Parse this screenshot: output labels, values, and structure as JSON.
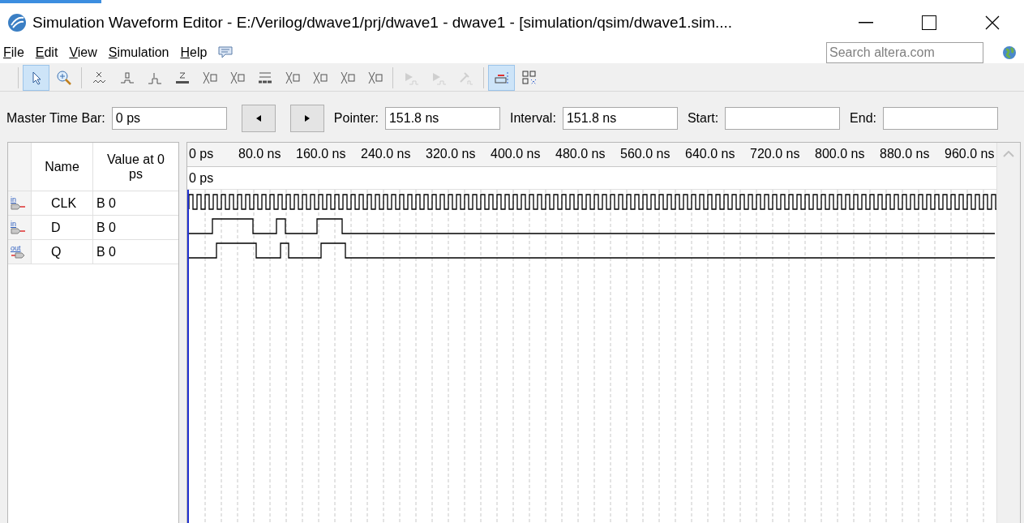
{
  "window": {
    "title": "Simulation Waveform Editor - E:/Verilog/dwave1/prj/dwave1 - dwave1 - [simulation/qsim/dwave1.sim...."
  },
  "menu": [
    {
      "label": "File"
    },
    {
      "label": "Edit"
    },
    {
      "label": "View"
    },
    {
      "label": "Simulation"
    },
    {
      "label": "Help"
    }
  ],
  "search": {
    "placeholder": "Search altera.com"
  },
  "toolbar": [
    [
      {
        "kind": "pointer",
        "selected": true,
        "disabled": false
      },
      {
        "kind": "zoom",
        "selected": false,
        "disabled": false
      }
    ],
    [
      {
        "kind": "unknown",
        "selected": false,
        "disabled": false
      },
      {
        "kind": "low",
        "selected": false,
        "disabled": false
      },
      {
        "kind": "high",
        "selected": false,
        "disabled": false
      },
      {
        "kind": "highz",
        "selected": false,
        "disabled": false
      },
      {
        "kind": "cross",
        "selected": false,
        "disabled": false
      },
      {
        "kind": "cross",
        "selected": false,
        "disabled": false
      },
      {
        "kind": "invert",
        "selected": false,
        "disabled": false
      },
      {
        "kind": "cross",
        "selected": false,
        "disabled": false
      },
      {
        "kind": "cross",
        "selected": false,
        "disabled": false
      },
      {
        "kind": "cross",
        "selected": false,
        "disabled": false
      },
      {
        "kind": "cross",
        "selected": false,
        "disabled": false
      }
    ],
    [
      {
        "kind": "play",
        "selected": false,
        "disabled": true
      },
      {
        "kind": "play",
        "selected": false,
        "disabled": true
      },
      {
        "kind": "hammer",
        "selected": false,
        "disabled": true
      }
    ],
    [
      {
        "kind": "snap",
        "selected": true,
        "disabled": false
      },
      {
        "kind": "grid",
        "selected": false,
        "disabled": false
      }
    ]
  ],
  "time_bar": {
    "master_label": "Master Time Bar:",
    "master_value": "0 ps",
    "pointer_label": "Pointer:",
    "pointer_value": "151.8 ns",
    "interval_label": "Interval:",
    "interval_value": "151.8 ns",
    "start_label": "Start:",
    "end_label": "End:"
  },
  "columns": {
    "name": "Name",
    "value": "Value at 0 ps"
  },
  "ruler": {
    "ticks": [
      "0 ps",
      "80.0 ns",
      "160.0 ns",
      "240.0 ns",
      "320.0 ns",
      "400.0 ns",
      "480.0 ns",
      "560.0 ns",
      "640.0 ns",
      "720.0 ns",
      "800.0 ns",
      "880.0 ns",
      "960.0 ns"
    ],
    "cursor_label": "0 ps"
  },
  "signals": [
    {
      "name": "CLK",
      "value": "B 0",
      "direction": "in"
    },
    {
      "name": "D",
      "value": "B 0",
      "direction": "in"
    },
    {
      "name": "Q",
      "value": "B 0",
      "direction": "out"
    }
  ]
}
